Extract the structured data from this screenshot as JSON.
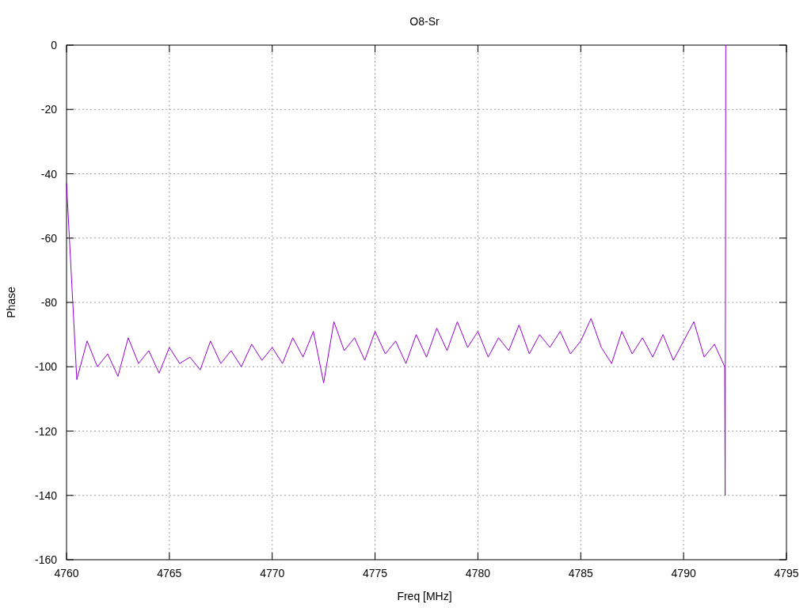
{
  "chart_data": {
    "type": "line",
    "title": "O8-Sr",
    "xlabel": "Freq [MHz]",
    "ylabel": "Phase",
    "xlim": [
      4760,
      4795
    ],
    "ylim": [
      -160,
      0
    ],
    "xticks": [
      4760,
      4765,
      4770,
      4775,
      4780,
      4785,
      4790,
      4795
    ],
    "yticks": [
      -160,
      -140,
      -120,
      -100,
      -80,
      -60,
      -40,
      -20,
      0
    ],
    "x": [
      4760,
      4760.5,
      4761,
      4761.5,
      4762,
      4762.5,
      4763,
      4763.5,
      4764,
      4764.5,
      4765,
      4765.5,
      4766,
      4766.5,
      4767,
      4767.5,
      4768,
      4768.5,
      4769,
      4769.5,
      4770,
      4770.5,
      4771,
      4771.5,
      4772,
      4772.5,
      4773,
      4773.5,
      4774,
      4774.5,
      4775,
      4775.5,
      4776,
      4776.5,
      4777,
      4777.5,
      4778,
      4778.5,
      4779,
      4779.5,
      4780,
      4780.5,
      4781,
      4781.5,
      4782,
      4782.5,
      4783,
      4783.5,
      4784,
      4784.5,
      4785,
      4785.5,
      4786,
      4786.5,
      4787,
      4787.5,
      4788,
      4788.5,
      4789,
      4789.5,
      4790,
      4790.5,
      4791,
      4791.5,
      4792,
      4792.02,
      4792.05
    ],
    "grid": true,
    "series": [
      {
        "color": "#9400d3",
        "values": [
          -43,
          -104,
          -92,
          -100,
          -96,
          -103,
          -91,
          -99,
          -95,
          -102,
          -94,
          -99,
          -97,
          -101,
          -92,
          -99,
          -95,
          -100,
          -93,
          -98,
          -94,
          -99,
          -91,
          -97,
          -89,
          -105,
          -86,
          -95,
          -91,
          -98,
          -89,
          -96,
          -92,
          -99,
          -90,
          -97,
          -88,
          -95,
          -86,
          -94,
          -89,
          -97,
          -91,
          -95,
          -87,
          -96,
          -90,
          -94,
          -89,
          -96,
          -92,
          -85,
          -94,
          -99,
          -89,
          -96,
          -91,
          -97,
          -90,
          -98,
          -92,
          -86,
          -97,
          -93,
          -100,
          -140,
          0
        ]
      }
    ]
  }
}
